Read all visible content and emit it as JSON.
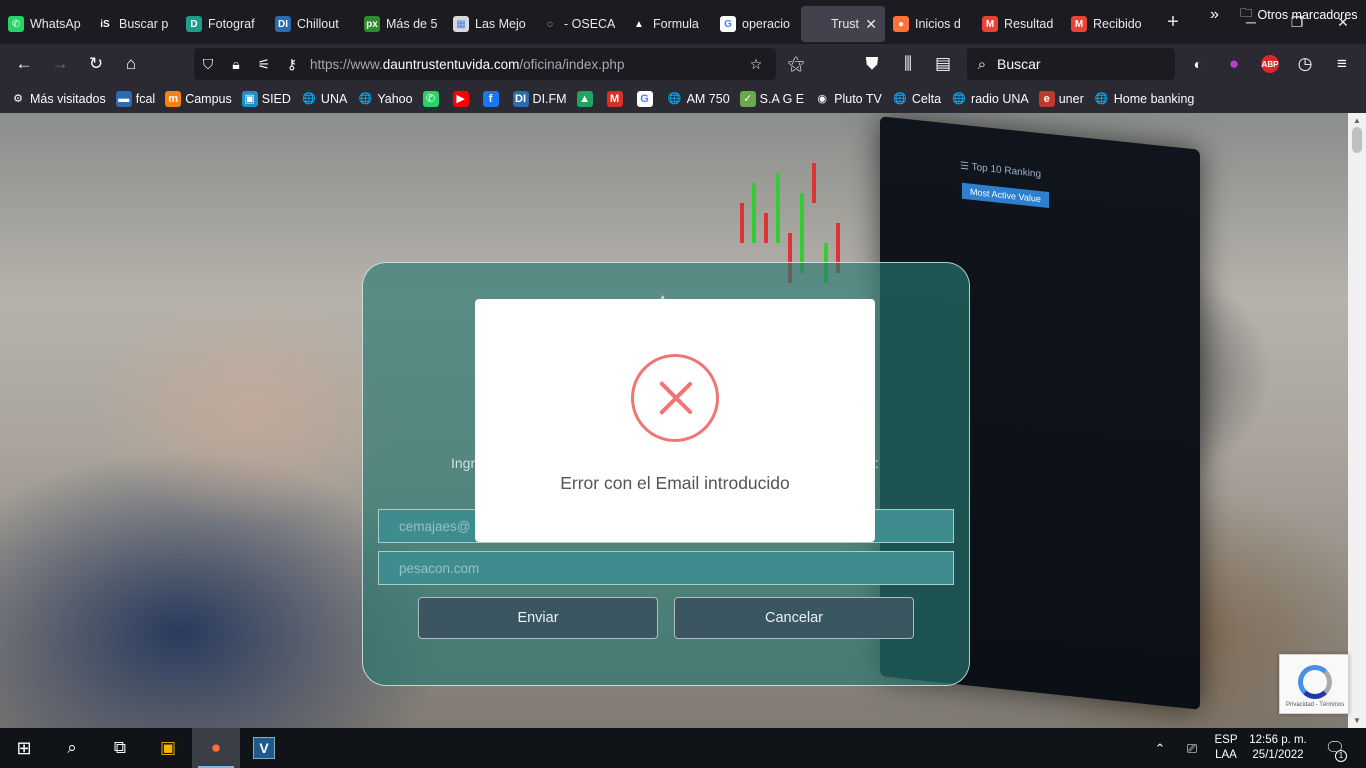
{
  "browser": {
    "tabs": [
      {
        "label": "WhatsAp",
        "icon": "whatsapp-icon",
        "color": "#25d366",
        "glyph": "✆"
      },
      {
        "label": "Buscar p",
        "icon": "issuu-icon",
        "color": "#1c1b22",
        "glyph": "iS"
      },
      {
        "label": "Fotograf",
        "icon": "page-icon",
        "color": "#1e9e8a",
        "glyph": "D"
      },
      {
        "label": "Chillout",
        "icon": "difm-icon",
        "color": "#2b6cb0",
        "glyph": "DI"
      },
      {
        "label": "Más de 5",
        "icon": "px-icon",
        "color": "#2e8b2e",
        "glyph": "px"
      },
      {
        "label": "Las Mejo",
        "icon": "image-icon",
        "color": "#d9d9d9",
        "glyph": "▦"
      },
      {
        "label": "- OSECA",
        "icon": "loading-icon",
        "color": "#1c1b22",
        "glyph": "◌"
      },
      {
        "label": "Formula",
        "icon": "triangle-icon",
        "color": "#1c1b22",
        "glyph": "▲"
      },
      {
        "label": "operacio",
        "icon": "google-icon",
        "color": "#ffffff",
        "glyph": "G"
      },
      {
        "label": "Trustinves",
        "icon": "blank-icon",
        "color": "#42414d",
        "glyph": "",
        "active": true
      },
      {
        "label": "Inicios d",
        "icon": "firefox-icon",
        "color": "#ff7139",
        "glyph": "●"
      },
      {
        "label": "Resultad",
        "icon": "gmail-icon",
        "color": "#ea4335",
        "glyph": "M"
      },
      {
        "label": "Recibido",
        "icon": "gmail-icon",
        "color": "#ea4335",
        "glyph": "M"
      }
    ],
    "new_tab": "+",
    "url_scheme": "https://www.",
    "url_domain": "dauntrustentuvida.com",
    "url_path": "/oficina/index.php",
    "search_placeholder": "Buscar",
    "bookmarks": [
      {
        "label": "Más visitados",
        "icon": "gear-icon",
        "glyph": "⚙",
        "color": "#2b2a33"
      },
      {
        "label": "fcal",
        "icon": "fcal-icon",
        "glyph": "▬",
        "color": "#2b6cb0"
      },
      {
        "label": "Campus",
        "icon": "moodle-icon",
        "glyph": "m",
        "color": "#f98012"
      },
      {
        "label": "SIED",
        "icon": "sied-icon",
        "glyph": "▣",
        "color": "#1e90c8"
      },
      {
        "label": "UNA",
        "icon": "globe-icon",
        "glyph": "🌐",
        "color": "#2b2a33"
      },
      {
        "label": "Yahoo",
        "icon": "globe-icon",
        "glyph": "🌐",
        "color": "#2b2a33"
      },
      {
        "label": "",
        "icon": "whatsapp-icon",
        "glyph": "✆",
        "color": "#25d366"
      },
      {
        "label": "",
        "icon": "youtube-icon",
        "glyph": "▶",
        "color": "#ff0000"
      },
      {
        "label": "",
        "icon": "facebook-icon",
        "glyph": "f",
        "color": "#1877f2"
      },
      {
        "label": "DI.FM",
        "icon": "difm-icon",
        "glyph": "DI",
        "color": "#2b6cb0"
      },
      {
        "label": "",
        "icon": "drive-icon",
        "glyph": "▲",
        "color": "#1fa463"
      },
      {
        "label": "",
        "icon": "mail-icon",
        "glyph": "M",
        "color": "#d93025"
      },
      {
        "label": "",
        "icon": "google-icon",
        "glyph": "G",
        "color": "#ffffff"
      },
      {
        "label": "AM 750",
        "icon": "globe-icon",
        "glyph": "🌐",
        "color": "#2b2a33"
      },
      {
        "label": "S.A G E",
        "icon": "sage-icon",
        "glyph": "✓",
        "color": "#6aa84f"
      },
      {
        "label": "Pluto TV",
        "icon": "pluto-icon",
        "glyph": "◉",
        "color": "#2b2a33"
      },
      {
        "label": "Celta",
        "icon": "globe-icon",
        "glyph": "🌐",
        "color": "#2b2a33"
      },
      {
        "label": "radio UNA",
        "icon": "globe-icon",
        "glyph": "🌐",
        "color": "#2b2a33"
      },
      {
        "label": "uner",
        "icon": "uner-icon",
        "glyph": "e",
        "color": "#c0392b"
      },
      {
        "label": "Home banking",
        "icon": "globe-icon",
        "glyph": "🌐",
        "color": "#2b2a33"
      }
    ],
    "other_bookmarks": "Otros marcadores"
  },
  "page": {
    "monitor_rank": "☰ Top 10 Ranking",
    "monitor_tab": "Most Active Value",
    "hint_left": "Ingr",
    "hint_right": "a:",
    "email_placeholder": "cemajaes@",
    "second_field": "pesacon.com",
    "send_button": "Enviar",
    "cancel_button": "Cancelar",
    "error_message": "Error con el Email introducido",
    "recaptcha_text": "Privacidad - Términos"
  },
  "taskbar": {
    "lang_top": "ESP",
    "lang_bottom": "LAA",
    "time": "12:56 p. m.",
    "date": "25/1/2022",
    "notifications": "1"
  },
  "colors": {
    "error_red": "#f27474",
    "panel_teal": "#267870",
    "button_slate": "#3a5660"
  }
}
